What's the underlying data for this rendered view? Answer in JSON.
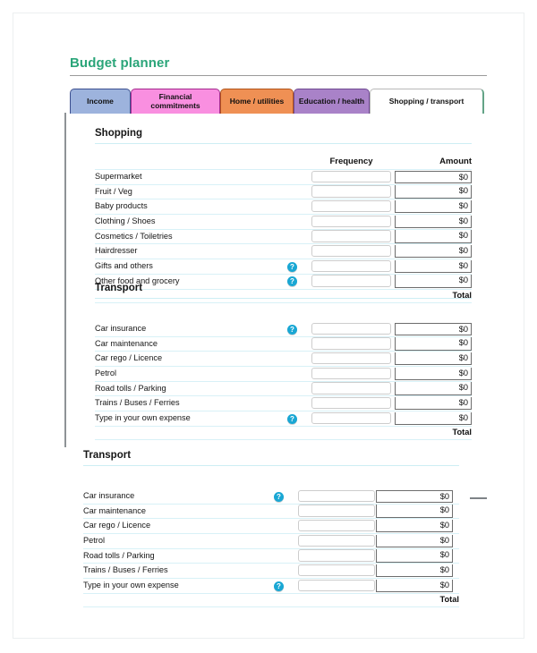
{
  "page": {
    "title": "Budget planner",
    "title_color": "#2aa579",
    "accent_help_color": "#19a7d4"
  },
  "tabs": [
    {
      "label": "Income",
      "color": "#9db3dd",
      "active": false
    },
    {
      "label": "Financial commitments",
      "color": "#f98fe0",
      "active": false
    },
    {
      "label": "Home / utilities",
      "color": "#ef9054",
      "active": false
    },
    {
      "label": "Education / health",
      "color": "#a982c8",
      "active": false
    },
    {
      "label": "Shopping / transport",
      "color": "#ffffff",
      "active": true
    }
  ],
  "columns": {
    "frequency": "Frequency",
    "amount": "Amount",
    "total": "Total"
  },
  "sections": [
    {
      "title": "Shopping",
      "show_headers": true,
      "rows": [
        {
          "label": "Supermarket",
          "help": false,
          "frequency": "",
          "amount": "$0"
        },
        {
          "label": "Fruit / Veg",
          "help": false,
          "frequency": "",
          "amount": "$0"
        },
        {
          "label": "Baby products",
          "help": false,
          "frequency": "",
          "amount": "$0"
        },
        {
          "label": "Clothing / Shoes",
          "help": false,
          "frequency": "",
          "amount": "$0"
        },
        {
          "label": "Cosmetics / Toiletries",
          "help": false,
          "frequency": "",
          "amount": "$0"
        },
        {
          "label": "Hairdresser",
          "help": false,
          "frequency": "",
          "amount": "$0"
        },
        {
          "label": "Gifts and others",
          "help": true,
          "frequency": "",
          "amount": "$0"
        },
        {
          "label": "Other food and grocery",
          "help": true,
          "frequency": "",
          "amount": "$0"
        }
      ]
    },
    {
      "title": "Transport",
      "show_headers": false,
      "rows": [
        {
          "label": "Car insurance",
          "help": true,
          "frequency": "",
          "amount": "$0"
        },
        {
          "label": "Car maintenance",
          "help": false,
          "frequency": "",
          "amount": "$0"
        },
        {
          "label": "Car rego / Licence",
          "help": false,
          "frequency": "",
          "amount": "$0"
        },
        {
          "label": "Petrol",
          "help": false,
          "frequency": "",
          "amount": "$0"
        },
        {
          "label": "Road tolls / Parking",
          "help": false,
          "frequency": "",
          "amount": "$0"
        },
        {
          "label": "Trains / Buses / Ferries",
          "help": false,
          "frequency": "",
          "amount": "$0"
        },
        {
          "label": "Type in your own expense",
          "help": true,
          "frequency": "",
          "amount": "$0"
        }
      ]
    },
    {
      "title": "Transport",
      "show_headers": false,
      "rows": [
        {
          "label": "Car insurance",
          "help": true,
          "frequency": "",
          "amount": "$0"
        },
        {
          "label": "Car maintenance",
          "help": false,
          "frequency": "",
          "amount": "$0"
        },
        {
          "label": "Car rego / Licence",
          "help": false,
          "frequency": "",
          "amount": "$0"
        },
        {
          "label": "Petrol",
          "help": false,
          "frequency": "",
          "amount": "$0"
        },
        {
          "label": "Road tolls / Parking",
          "help": false,
          "frequency": "",
          "amount": "$0"
        },
        {
          "label": "Trains / Buses / Ferries",
          "help": false,
          "frequency": "",
          "amount": "$0"
        },
        {
          "label": "Type in your own expense",
          "help": true,
          "frequency": "",
          "amount": "$0"
        }
      ]
    }
  ]
}
